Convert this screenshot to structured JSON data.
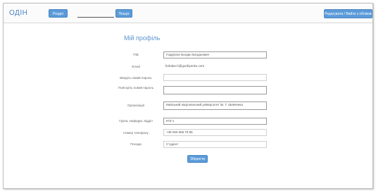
{
  "header": {
    "app_title": "ОДІН",
    "nav_button_label": "Розділ",
    "search": {
      "value": "",
      "placeholder": ""
    },
    "search_button_label": "Пошук",
    "logout_button_label": "Редагувати / Вийти з облікового запису"
  },
  "profile": {
    "title": "Мій профіль",
    "fields": {
      "full_name": {
        "label": "ПІБ",
        "value": "Гордієнко Богдан Богданович"
      },
      "email": {
        "label": "Email",
        "value": "bohdan.h@gordiyenko.com"
      },
      "new_password": {
        "label": "Введіть новий пароль",
        "value": ""
      },
      "confirm_password": {
        "label": "Повторіть новий пароль",
        "value": ""
      },
      "organization": {
        "label": "Організація",
        "value": "Київський національний університет ім. Т. Шевченка"
      },
      "group": {
        "label": "Група, кафедра, відділ",
        "value": "ІПЗ-1"
      },
      "phone": {
        "label": "Номер телефону",
        "value": "+38 050 655 78 95"
      },
      "position": {
        "label": "Посада",
        "value": "Студент"
      }
    },
    "save_button_label": "Зберегти"
  },
  "colors": {
    "accent": "#5b9bd9",
    "title": "#4a7fc0"
  }
}
